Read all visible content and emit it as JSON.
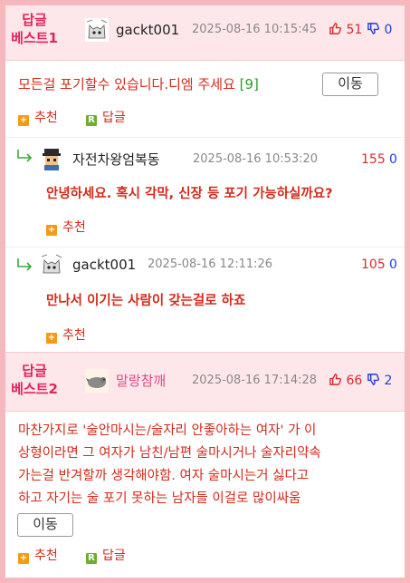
{
  "best1": {
    "label_line1": "답글",
    "label_line2": "베스트1",
    "username": "gackt001",
    "timestamp": "2025-08-16 10:15:45",
    "up": "51",
    "down": "0",
    "text": "모든걸 포기할수 있습니다.디엠 주세요",
    "reply_count": "[9]",
    "move_label": "이동",
    "recommend_label": "추천",
    "reply_label": "답글"
  },
  "replies": [
    {
      "username": "자전차왕엄복동",
      "timestamp": "2025-08-16 10:53:20",
      "up": "155",
      "down": "0",
      "text": "안녕하세요. 혹시 각막, 신장 등 포기 가능하실까요?",
      "recommend_label": "추천"
    },
    {
      "username": "gackt001",
      "timestamp": "2025-08-16 12:11:26",
      "up": "105",
      "down": "0",
      "text": "만나서 이기는 사람이 갖는걸로 하죠",
      "recommend_label": "추천"
    }
  ],
  "best2": {
    "label_line1": "답글",
    "label_line2": "베스트2",
    "username": "말랑참깨",
    "timestamp": "2025-08-16 17:14:28",
    "up": "66",
    "down": "2",
    "lines": [
      "마찬가지로 '술안마시는/술자리 안좋아하는 여자' 가 이",
      "상형이라면 그 여자가 남친/남편 술마시거나 술자리약속",
      "가는걸 반겨할까 생각해야함. 여자 술마시는거 싫다고",
      "하고 자기는 술 포기 못하는 남자들 이걸로 많이싸움"
    ],
    "move_label": "이동",
    "recommend_label": "추천",
    "reply_label": "답글"
  },
  "colors": {
    "accent_pink": "#e0245e",
    "text_red": "#d42a1a",
    "up_red": "#d92b2b",
    "down_blue": "#1f3fd6",
    "header_bg": "#fde7ea",
    "frame_bg": "#f7b8bd"
  },
  "icons": [
    "thumbs-up-icon",
    "thumbs-down-icon",
    "reply-arrow-icon",
    "plus-square-icon",
    "reply-square-icon",
    "avatar-cat-icon",
    "avatar-pixel-icon",
    "avatar-bird-icon"
  ]
}
